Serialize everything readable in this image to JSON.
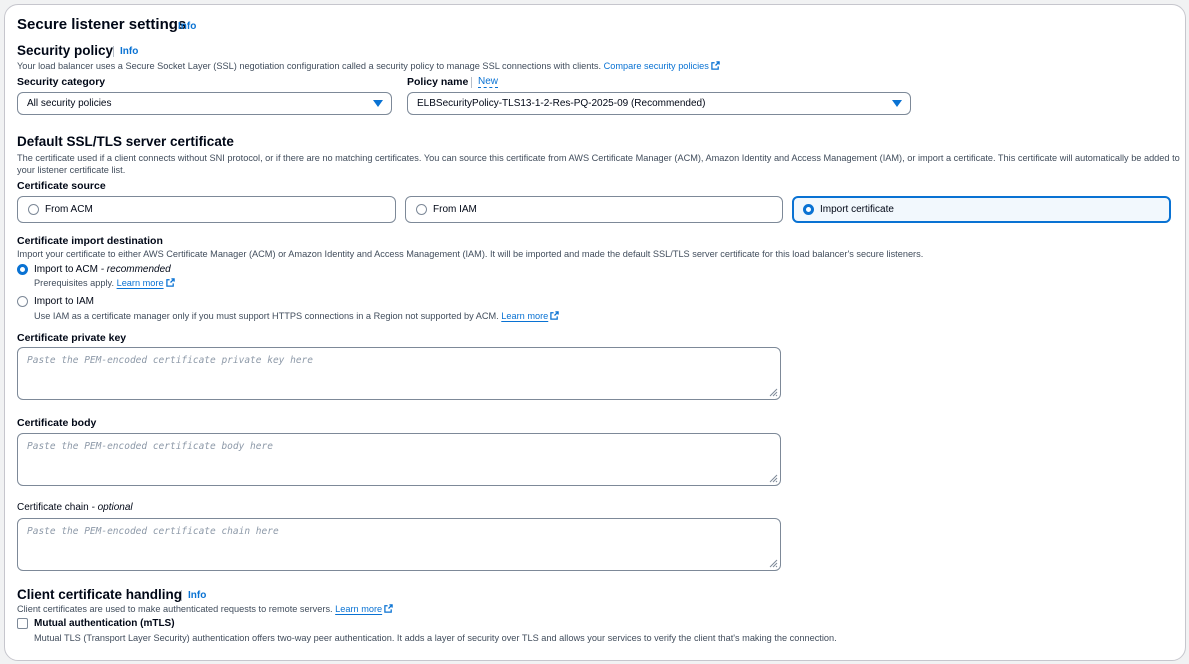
{
  "header": {
    "title": "Secure listener settings",
    "info": "Info"
  },
  "security_policy": {
    "title": "Security policy",
    "info": "Info",
    "description": "Your load balancer uses a Secure Socket Layer (SSL) negotiation configuration called a security policy to manage SSL connections with clients.",
    "compare_link": "Compare security policies",
    "category_label": "Security category",
    "category_value": "All security policies",
    "policy_label": "Policy name",
    "policy_new": "New",
    "policy_value": "ELBSecurityPolicy-TLS13-1-2-Res-PQ-2025-09 (Recommended)"
  },
  "default_cert": {
    "title": "Default SSL/TLS server certificate",
    "description_line1": "The certificate used if a client connects without SNI protocol, or if there are no matching certificates. You can source this certificate from AWS Certificate Manager (ACM), Amazon Identity and Access Management (IAM), or import a certificate. This certificate will automatically be added to",
    "description_line2": "your listener certificate list.",
    "source_label": "Certificate source",
    "sources": [
      {
        "label": "From ACM",
        "selected": false
      },
      {
        "label": "From IAM",
        "selected": false
      },
      {
        "label": "Import certificate",
        "selected": true
      }
    ]
  },
  "import_dest": {
    "title": "Certificate import destination",
    "description": "Import your certificate to either AWS Certificate Manager (ACM) or Amazon Identity and Access Management (IAM). It will be imported and made the default SSL/TLS server certificate for this load balancer's secure listeners.",
    "acm_label": "Import to ACM",
    "acm_recommended": "- recommended",
    "acm_desc": "Prerequisites apply.",
    "acm_link": "Learn more",
    "iam_label": "Import to IAM",
    "iam_desc": "Use IAM as a certificate manager only if you must support HTTPS connections in a Region not supported by ACM.",
    "iam_link": "Learn more",
    "selected": "acm"
  },
  "fields": {
    "private_key_label": "Certificate private key",
    "private_key_placeholder": "Paste the PEM-encoded certificate private key here",
    "body_label": "Certificate body",
    "body_placeholder": "Paste the PEM-encoded certificate body here",
    "chain_label": "Certificate chain",
    "chain_optional": "- optional",
    "chain_placeholder": "Paste the PEM-encoded certificate chain here"
  },
  "client_cert": {
    "title": "Client certificate handling",
    "info": "Info",
    "description": "Client certificates are used to make authenticated requests to remote servers.",
    "link": "Learn more",
    "mtls_label": "Mutual authentication (mTLS)",
    "mtls_desc": "Mutual TLS (Transport Layer Security) authentication offers two-way peer authentication. It adds a layer of security over TLS and allows your services to verify the client that's making the connection.",
    "mtls_checked": false
  },
  "colors": {
    "accent": "#0972d3",
    "text": "#000716",
    "muted": "#414d5c",
    "border": "#7d8998"
  },
  "icons": [
    "external-link-icon",
    "caret-down-icon",
    "resize-grip-icon"
  ]
}
